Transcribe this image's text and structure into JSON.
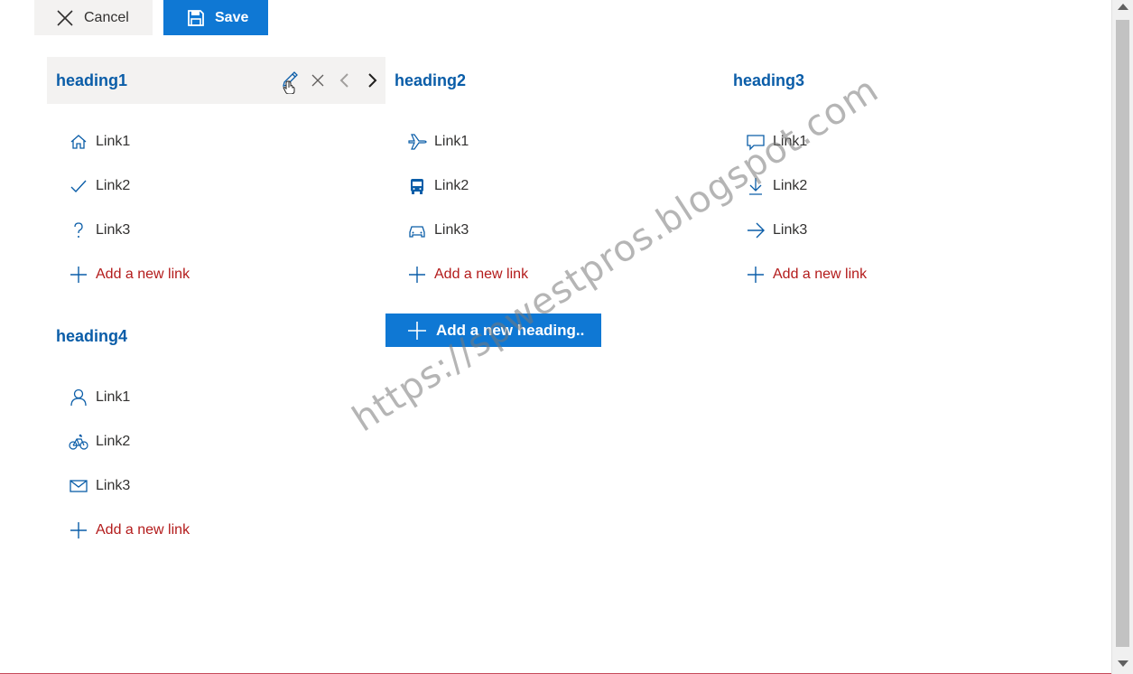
{
  "toolbar": {
    "cancel_label": "Cancel",
    "save_label": "Save"
  },
  "headings": [
    {
      "title": "heading1",
      "links": [
        {
          "label": "Link1",
          "icon": "home-icon"
        },
        {
          "label": "Link2",
          "icon": "checkmark-icon"
        },
        {
          "label": "Link3",
          "icon": "question-icon"
        }
      ],
      "add_label": "Add a new link"
    },
    {
      "title": "heading2",
      "links": [
        {
          "label": "Link1",
          "icon": "airplane-icon"
        },
        {
          "label": "Link2",
          "icon": "bus-icon"
        },
        {
          "label": "Link3",
          "icon": "car-icon"
        }
      ],
      "add_label": "Add a new link"
    },
    {
      "title": "heading3",
      "links": [
        {
          "label": "Link1",
          "icon": "comment-icon"
        },
        {
          "label": "Link2",
          "icon": "download-icon"
        },
        {
          "label": "Link3",
          "icon": "arrow-right-icon"
        }
      ],
      "add_label": "Add a new link"
    },
    {
      "title": "heading4",
      "links": [
        {
          "label": "Link1",
          "icon": "person-icon"
        },
        {
          "label": "Link2",
          "icon": "bicycle-icon"
        },
        {
          "label": "Link3",
          "icon": "mail-icon"
        }
      ],
      "add_label": "Add a new link"
    }
  ],
  "add_heading_label": "Add a new heading..",
  "watermark_text": "https://spwestpros.blogspot.com",
  "colors": {
    "accent": "#0f78d4",
    "heading": "#0a5da8",
    "add_link": "#b31b1b"
  }
}
